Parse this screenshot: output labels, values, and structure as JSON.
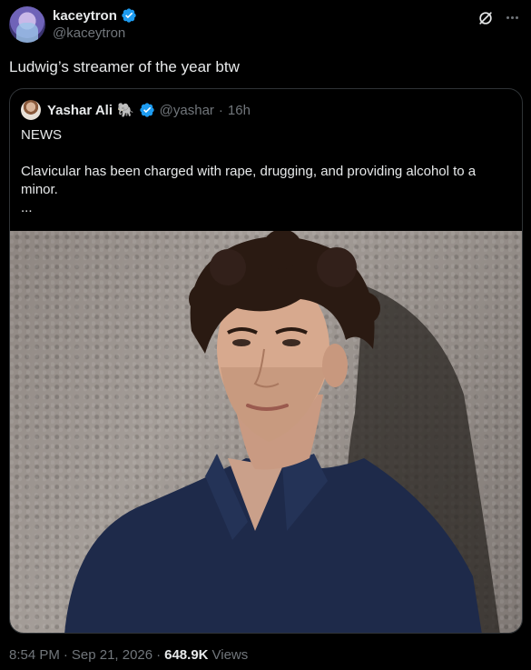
{
  "author": {
    "display_name": "kaceytron",
    "handle": "@kaceytron",
    "verified": true,
    "icons": [
      "verified-badge-icon",
      "grok-icon",
      "more-icon"
    ]
  },
  "tweet": {
    "text": "Ludwig’s streamer of the year btw"
  },
  "quoted": {
    "display_name": "Yashar Ali",
    "emoji": "🐘",
    "handle": "@yashar",
    "separator": "·",
    "time": "16h",
    "line1": "NEWS",
    "line2": "Clavicular has been charged with rape, drugging, and providing alcohol to a minor.",
    "line3": "...",
    "image_alt": "photo-of-young-man-in-navy-polo-against-textured-wall"
  },
  "footer": {
    "time": "8:54 PM",
    "dot1": "·",
    "date": "Sep 21, 2026",
    "dot2": "·",
    "views_count": "648.9K",
    "views_label": "Views"
  },
  "colors": {
    "background": "#000000",
    "text": "#e7e9ea",
    "secondary": "#71767b",
    "verified": "#1d9bf0",
    "border": "#2f3336"
  }
}
